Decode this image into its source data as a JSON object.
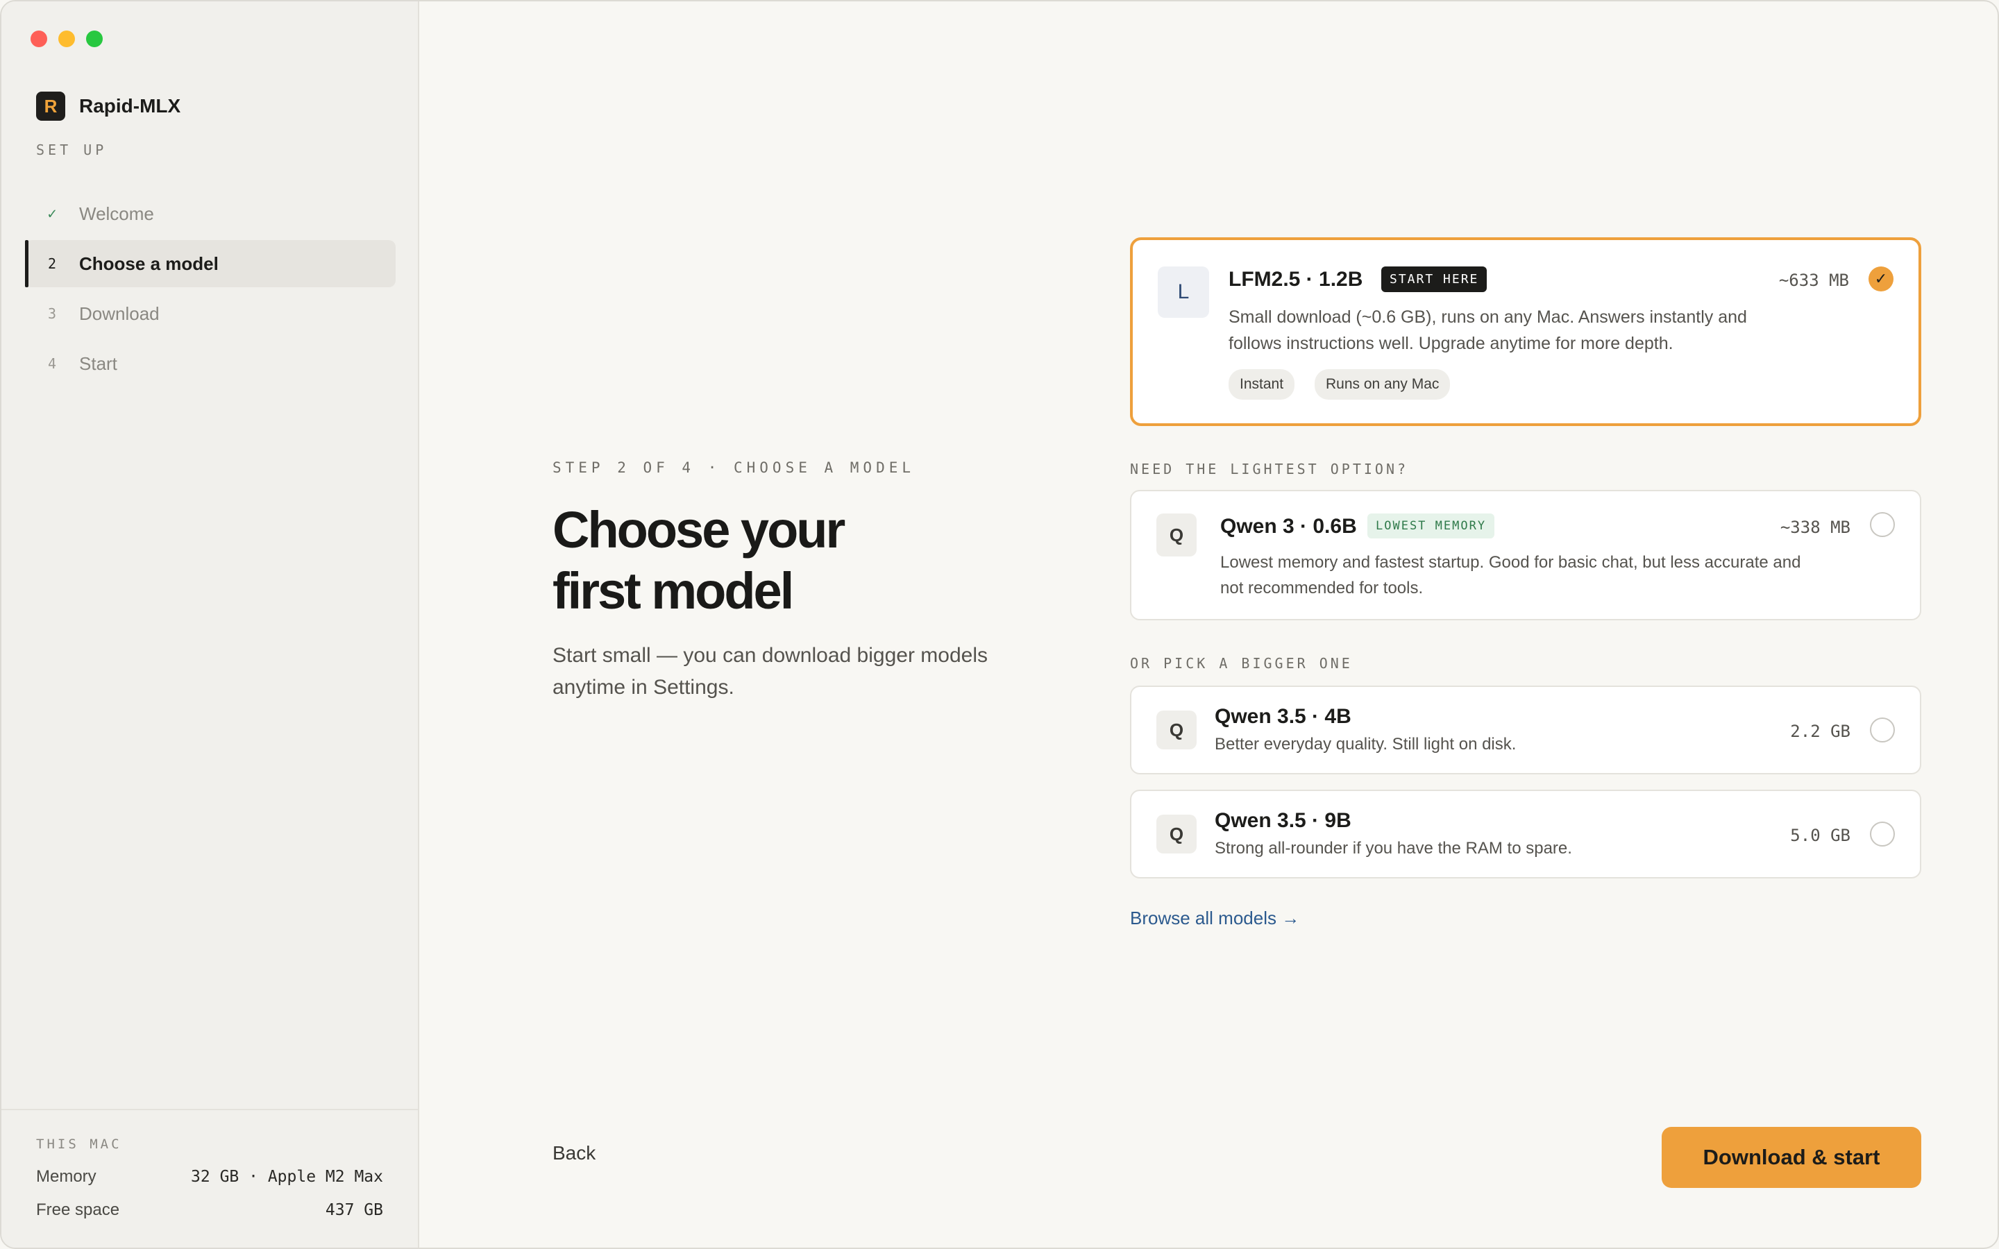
{
  "window": {
    "traffic_lights": [
      "close",
      "minimize",
      "zoom"
    ]
  },
  "sidebar": {
    "brand": {
      "logo_letter": "R",
      "name": "Rapid-MLX"
    },
    "section_label": "SET UP",
    "steps": [
      {
        "marker": "✓",
        "label": "Welcome",
        "state": "done"
      },
      {
        "marker": "2",
        "label": "Choose a model",
        "state": "active"
      },
      {
        "marker": "3",
        "label": "Download",
        "state": "pending"
      },
      {
        "marker": "4",
        "label": "Start",
        "state": "pending"
      }
    ],
    "mac": {
      "title": "THIS MAC",
      "memory_label": "Memory",
      "memory_value": "32 GB · Apple M2 Max",
      "free_space_label": "Free space",
      "free_space_value": "437 GB"
    }
  },
  "main": {
    "eyebrow": "STEP 2 OF 4 · CHOOSE A MODEL",
    "headline_line1": "Choose your",
    "headline_line2": "first model",
    "subtext": "Start small — you can download bigger models anytime in Settings.",
    "recommended": {
      "avatar": "L",
      "title": "LFM2.5 · 1.2B",
      "badge": "START HERE",
      "size": "~633 MB",
      "desc_line1": "Small download (~0.6 GB), runs on any Mac. Answers instantly and",
      "desc_line2": "follows instructions well. Upgrade anytime for more depth.",
      "tags": [
        "Instant",
        "Runs on any Mac"
      ],
      "selected": true,
      "check": "✓"
    },
    "lightest_label": "NEED THE LIGHTEST OPTION?",
    "lightest": {
      "avatar": "Q",
      "title": "Qwen 3 · 0.6B",
      "badge": "LOWEST MEMORY",
      "size": "~338 MB",
      "desc_line1": "Lowest memory and fastest startup. Good for basic chat, but less accurate and",
      "desc_line2": "not recommended for tools.",
      "selected": false
    },
    "bigger_label": "OR PICK A BIGGER ONE",
    "bigger": [
      {
        "avatar": "Q",
        "title": "Qwen 3.5 · 4B",
        "desc": "Better everyday quality. Still light on disk.",
        "size": "2.2 GB",
        "selected": false
      },
      {
        "avatar": "Q",
        "title": "Qwen 3.5 · 9B",
        "desc": "Strong all-rounder if you have the RAM to spare.",
        "size": "5.0 GB",
        "selected": false
      }
    ],
    "browse_link": "Browse all models →"
  },
  "footer": {
    "back_label": "Back",
    "primary_label": "Download & start"
  },
  "colors": {
    "accent": "#eea03c",
    "background": "#f8f7f3",
    "sidebar": "#f1f0ec",
    "link": "#2c5a8e",
    "done_check": "#3b8a5a"
  }
}
